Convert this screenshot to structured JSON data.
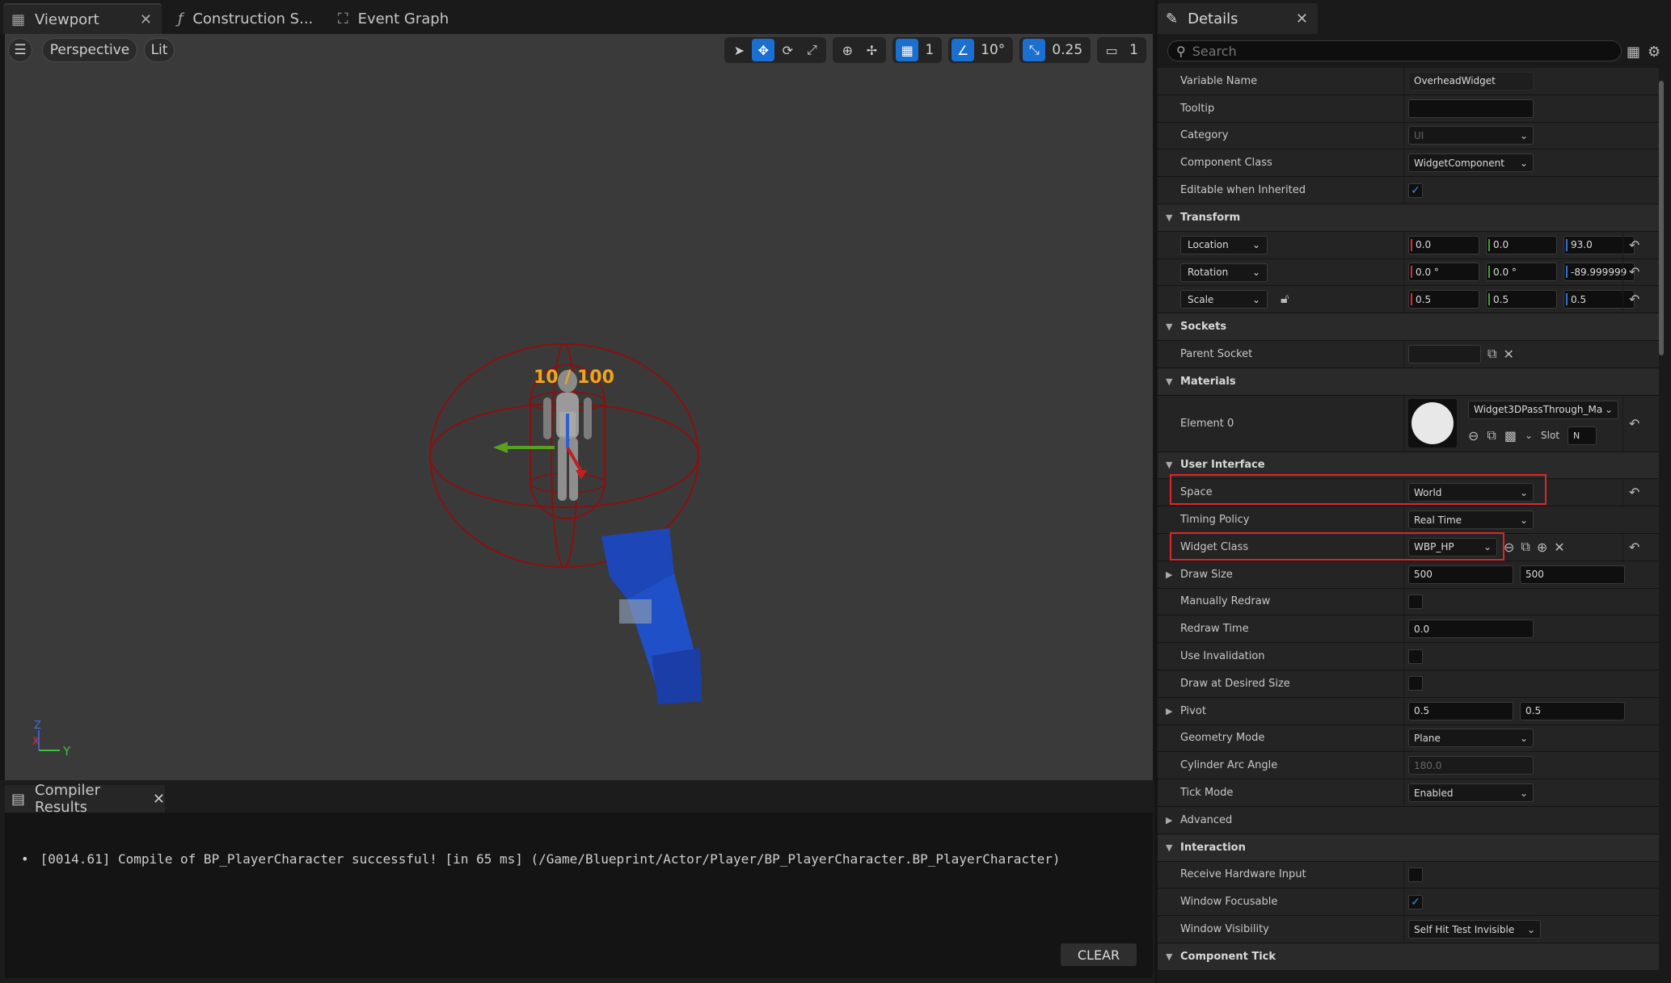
{
  "tabs": [
    {
      "label": "Viewport",
      "icon": "viewport-icon"
    },
    {
      "label": "Construction S...",
      "icon": "function-icon"
    },
    {
      "label": "Event Graph",
      "icon": "graph-icon"
    }
  ],
  "viewport": {
    "menu_icon": "hamburger-icon",
    "perspective_label": "Perspective",
    "lit_label": "Lit",
    "grid_snap": "1",
    "angle_snap": "10°",
    "scale_snap": "0.25",
    "camera_speed": "1",
    "hp_text": "10 / 100",
    "axis_z": "Z",
    "axis_x": "X",
    "axis_y": "Y"
  },
  "compiler": {
    "tab_label": "Compiler Results",
    "log": "[0014.61] Compile of BP_PlayerCharacter successful! [in 65 ms] (/Game/Blueprint/Actor/Player/BP_PlayerCharacter.BP_PlayerCharacter)",
    "clear_label": "CLEAR"
  },
  "details": {
    "tab_label": "Details",
    "search_placeholder": "Search",
    "variable_name_label": "Variable Name",
    "variable_name_value": "OverheadWidget",
    "tooltip_label": "Tooltip",
    "category_label": "Category",
    "category_value": "UI",
    "component_class_label": "Component Class",
    "component_class_value": "WidgetComponent",
    "editable_label": "Editable when Inherited",
    "transform_label": "Transform",
    "location_label": "Location",
    "location": [
      "0.0",
      "0.0",
      "93.0"
    ],
    "rotation_label": "Rotation",
    "rotation": [
      "0.0 °",
      "0.0 °",
      "-89.999999"
    ],
    "scale_label": "Scale",
    "scale": [
      "0.5",
      "0.5",
      "0.5"
    ],
    "sockets_label": "Sockets",
    "parent_socket_label": "Parent Socket",
    "materials_label": "Materials",
    "element0_label": "Element 0",
    "material_value": "Widget3DPassThrough_Ma",
    "slot_label": "Slot",
    "slot_value": "N",
    "ui_label": "User Interface",
    "space_label": "Space",
    "space_value": "World",
    "timing_label": "Timing Policy",
    "timing_value": "Real Time",
    "widget_class_label": "Widget Class",
    "widget_class_value": "WBP_HP",
    "draw_size_label": "Draw Size",
    "draw_size": [
      "500",
      "500"
    ],
    "manual_redraw_label": "Manually Redraw",
    "redraw_time_label": "Redraw Time",
    "redraw_time_value": "0.0",
    "use_invalidation_label": "Use Invalidation",
    "draw_desired_label": "Draw at Desired Size",
    "pivot_label": "Pivot",
    "pivot": [
      "0.5",
      "0.5"
    ],
    "geometry_label": "Geometry Mode",
    "geometry_value": "Plane",
    "cylinder_label": "Cylinder Arc Angle",
    "cylinder_value": "180.0",
    "tick_mode_label": "Tick Mode",
    "tick_mode_value": "Enabled",
    "advanced_label": "Advanced",
    "interaction_label": "Interaction",
    "receive_hw_label": "Receive Hardware Input",
    "window_focusable_label": "Window Focusable",
    "window_visibility_label": "Window Visibility",
    "window_visibility_value": "Self Hit Test Invisible",
    "component_tick_label": "Component Tick"
  }
}
